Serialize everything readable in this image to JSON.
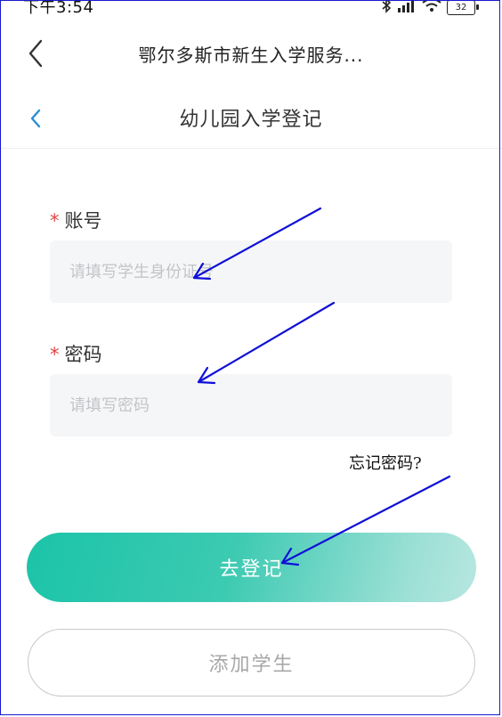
{
  "status_bar": {
    "time": "下午3:54",
    "battery": "32"
  },
  "header": {
    "title": "鄂尔多斯市新生入学服务..."
  },
  "sub_header": {
    "title": "幼儿园入学登记"
  },
  "form": {
    "required_mark": "*",
    "account": {
      "label": "账号",
      "placeholder": "请填写学生身份证号",
      "value": ""
    },
    "password": {
      "label": "密码",
      "placeholder": "请填写密码",
      "value": ""
    },
    "forgot_password": "忘记密码?"
  },
  "buttons": {
    "submit": "去登记",
    "add_student": "添加学生"
  },
  "colors": {
    "accent_start": "#1bc4a8",
    "accent_end": "#b7e7e0",
    "required": "#e04545",
    "annotation_arrow": "#1010d8",
    "back_arrow_blue": "#2b8fd6"
  }
}
